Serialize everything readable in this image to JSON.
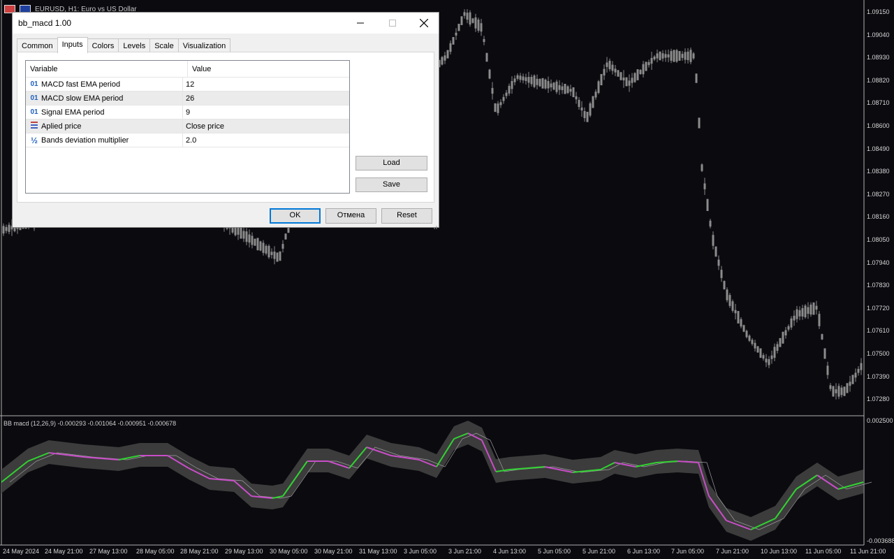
{
  "chart": {
    "symbol_title": "EURUSD, H1:  Euro vs US Dollar",
    "indicator_label": "BB macd (12,26,9) -0.000293 -0.001064 -0.000951 -0.000678",
    "price_labels": [
      "1.09150",
      "1.09040",
      "1.08930",
      "1.08820",
      "1.08710",
      "1.08600",
      "1.08490",
      "1.08380",
      "1.08270",
      "1.08160",
      "1.08050",
      "1.07940",
      "1.07830",
      "1.07720",
      "1.07610",
      "1.07500",
      "1.07390",
      "1.07280"
    ],
    "sub_labels": [
      "0.002500",
      "-0.003688"
    ],
    "time_labels": [
      "24 May 2024",
      "24 May 21:00",
      "27 May 13:00",
      "28 May 05:00",
      "28 May 21:00",
      "29 May 13:00",
      "30 May 05:00",
      "30 May 21:00",
      "31 May 13:00",
      "3 Jun 05:00",
      "3 Jun 21:00",
      "4 Jun 13:00",
      "5 Jun 05:00",
      "5 Jun 21:00",
      "6 Jun 13:00",
      "7 Jun 05:00",
      "7 Jun 21:00",
      "10 Jun 13:00",
      "11 Jun 05:00",
      "11 Jun 21:00"
    ],
    "colors": {
      "background": "#0a0a0f",
      "candle": "#8c8c8c",
      "band": "#3c3c3c",
      "macd_up": "#32d232",
      "macd_down": "#c84ec8",
      "signal": "#a0a0a0"
    }
  },
  "dialog": {
    "title": "bb_macd 1.00",
    "minimize_icon": "minimize-icon",
    "maximize_icon": "maximize-icon",
    "close_icon": "close-icon",
    "tabs": [
      "Common",
      "Inputs",
      "Colors",
      "Levels",
      "Scale",
      "Visualization"
    ],
    "active_tab": "Inputs",
    "table": {
      "header_variable": "Variable",
      "header_value": "Value",
      "rows": [
        {
          "icon": "01",
          "variable": "MACD fast EMA period",
          "value": "12"
        },
        {
          "icon": "01",
          "variable": "MACD slow EMA period",
          "value": "26"
        },
        {
          "icon": "01",
          "variable": "Signal EMA period",
          "value": "9"
        },
        {
          "icon": "enum",
          "variable": "Aplied price",
          "value": "Close price"
        },
        {
          "icon": "½",
          "variable": "Bands deviation multiplier",
          "value": "2.0"
        }
      ]
    },
    "load_label": "Load",
    "save_label": "Save",
    "ok_label": "OK",
    "cancel_label": "Отмена",
    "reset_label": "Reset"
  }
}
